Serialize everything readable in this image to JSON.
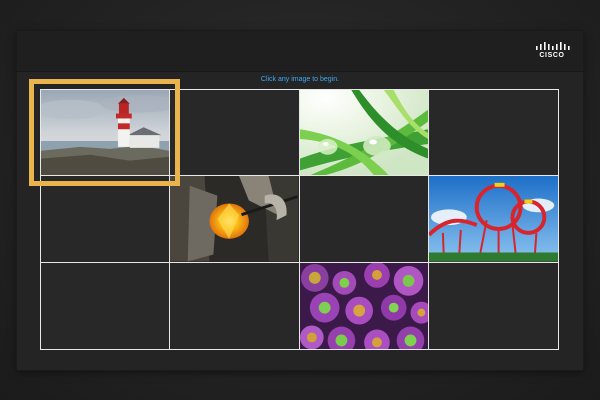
{
  "app": {
    "logo_text": "CISCO",
    "logo_icon": "cisco-bridge-logo"
  },
  "instruction": "Click any image to begin.",
  "colors": {
    "accent": "#3fa9f5",
    "selection": "#e9b44c",
    "grid_line": "#e8e8e8"
  },
  "grid": {
    "rows": 3,
    "cols": 4,
    "tiles": [
      {
        "name": "lighthouse",
        "image": "lighthouse",
        "selected": true
      },
      {
        "name": "empty",
        "image": null
      },
      {
        "name": "water-drops",
        "image": "grass-water-drops"
      },
      {
        "name": "empty",
        "image": null
      },
      {
        "name": "empty",
        "image": null
      },
      {
        "name": "glass-blowing",
        "image": "glass-blowing"
      },
      {
        "name": "empty",
        "image": null
      },
      {
        "name": "roller-coaster",
        "image": "roller-coaster"
      },
      {
        "name": "empty",
        "image": null
      },
      {
        "name": "empty",
        "image": null
      },
      {
        "name": "coral-polyps",
        "image": "coral-polyps"
      },
      {
        "name": "empty",
        "image": null
      }
    ]
  }
}
